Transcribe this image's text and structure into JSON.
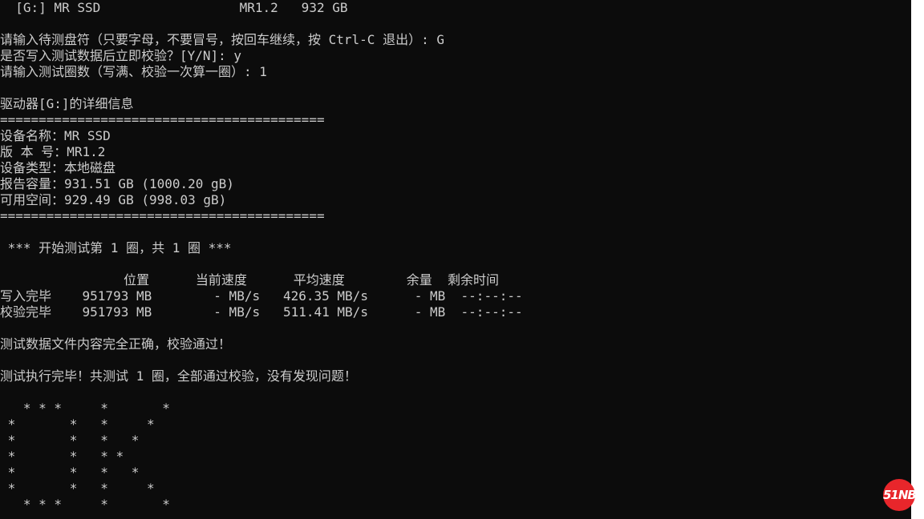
{
  "console": {
    "lines": [
      "  [G:] MR SSD                  MR1.2   932 GB",
      "",
      "请输入待测盘符（只要字母，不要冒号，按回车继续，按 Ctrl-C 退出）: G",
      "是否写入测试数据后立即校验？[Y/N]: y",
      "请输入测试圈数（写满、校验一次算一圈）: 1",
      "",
      "驱动器[G:]的详细信息",
      "==========================================",
      "设备名称：MR SSD",
      "版 本 号：MR1.2",
      "设备类型：本地磁盘",
      "报告容量：931.51 GB (1000.20 gB)",
      "可用空间：929.49 GB (998.03 gB)",
      "==========================================",
      "",
      " *** 开始测试第 1 圈，共 1 圈 ***",
      "",
      "                位置      当前速度      平均速度        余量  剩余时间",
      "写入完毕    951793 MB        - MB/s   426.35 MB/s      - MB  --:--:--",
      "校验完毕    951793 MB        - MB/s   511.41 MB/s      - MB  --:--:--",
      "",
      "测试数据文件内容完全正确，校验通过！",
      "",
      "测试执行完毕！共测试 1 圈，全部通过校验，没有发现问题！",
      "",
      "   * * *     *       *",
      " *       *   *     *",
      " *       *   *   *",
      " *       *   * *",
      " *       *   *   *",
      " *       *   *     *",
      "   * * *     *       *"
    ]
  },
  "watermark": {
    "text": "51NB",
    "color": "#e8262b"
  },
  "colors": {
    "console_background": "#0c0c0c",
    "console_text": "#cccccc",
    "scrollbar": "#ffffff"
  }
}
